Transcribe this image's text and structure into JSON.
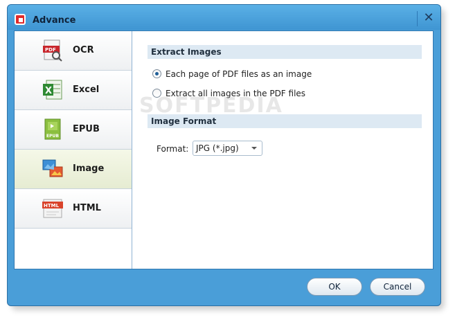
{
  "window": {
    "title": "Advance"
  },
  "sidebar": {
    "items": [
      {
        "label": "OCR",
        "icon": "ocr-pdf-icon"
      },
      {
        "label": "Excel",
        "icon": "excel-icon"
      },
      {
        "label": "EPUB",
        "icon": "epub-icon"
      },
      {
        "label": "Image",
        "icon": "image-icon",
        "active": true
      },
      {
        "label": "HTML",
        "icon": "html-icon"
      }
    ]
  },
  "extract": {
    "heading": "Extract Images",
    "option1": "Each page of PDF files as an image",
    "option2": "Extract all images in the PDF files",
    "selected": "option1"
  },
  "format": {
    "heading": "Image Format",
    "label": "Format:",
    "value": "JPG (*.jpg)"
  },
  "buttons": {
    "ok": "OK",
    "cancel": "Cancel"
  },
  "watermark": "SOFTPEDIA",
  "colors": {
    "titlebar": "#4a9ed8",
    "section_bg": "#dde9f3",
    "active_item": "#e6ecd2"
  }
}
